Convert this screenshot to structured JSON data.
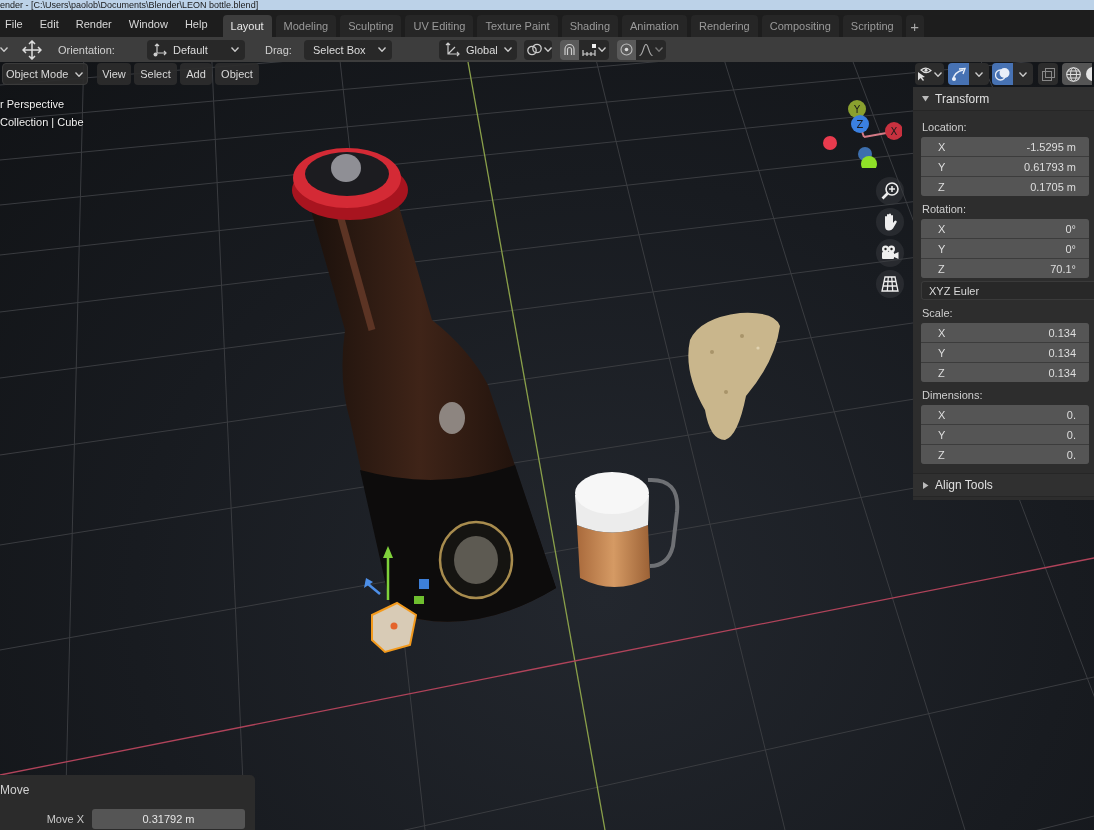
{
  "title_bar": {
    "title": "ender - [C:\\Users\\paolob\\Documents\\Blender\\LEON bottle.blend]"
  },
  "menu_bar": [
    "File",
    "Edit",
    "Render",
    "Window",
    "Help"
  ],
  "workspace_tabs": [
    {
      "label": "Layout",
      "selected": true
    },
    {
      "label": "Modeling",
      "selected": false
    },
    {
      "label": "Sculpting",
      "selected": false
    },
    {
      "label": "UV Editing",
      "selected": false
    },
    {
      "label": "Texture Paint",
      "selected": false
    },
    {
      "label": "Shading",
      "selected": false
    },
    {
      "label": "Animation",
      "selected": false
    },
    {
      "label": "Rendering",
      "selected": false
    },
    {
      "label": "Compositing",
      "selected": false
    },
    {
      "label": "Scripting",
      "selected": false
    }
  ],
  "add_workspace_button": "+",
  "tool_header": {
    "orientation_label": "Orientation:",
    "orientation": "Default",
    "drag_label": "Drag:",
    "drag": "Select Box",
    "transform_orientation": "Global",
    "snap_on": true,
    "proportional_editing_on": true
  },
  "viewport_header": {
    "mode": "Object Mode",
    "menus": [
      "View",
      "Select",
      "Add",
      "Object"
    ],
    "gizmos_on": true,
    "overlays_on": true,
    "xray_on": false
  },
  "viewport_overlay": {
    "view": "r Perspective",
    "collection": "Collection | Cube"
  },
  "navigation_gizmo": {
    "axes": [
      {
        "label": "Y",
        "color": "#8aa02f"
      },
      {
        "label": "Z",
        "color": "#3b80e0"
      },
      {
        "label": "X",
        "color": "#c8313f"
      }
    ],
    "negative_axes": [
      {
        "color": "#e83b4e"
      },
      {
        "color": "#3d6fae"
      },
      {
        "color": "#8fe028"
      }
    ]
  },
  "scene": {
    "cube_selected": true
  },
  "sidebar": {
    "panels": [
      {
        "title": "Transform",
        "expanded": true,
        "items": [
          {
            "kind": "group",
            "label": "Location:",
            "fields": [
              {
                "axis": "X",
                "value": "-1.5295 m"
              },
              {
                "axis": "Y",
                "value": "0.61793 m"
              },
              {
                "axis": "Z",
                "value": "0.1705 m"
              }
            ]
          },
          {
            "kind": "group",
            "label": "Rotation:",
            "fields": [
              {
                "axis": "X",
                "value": "0°"
              },
              {
                "axis": "Y",
                "value": "0°"
              },
              {
                "axis": "Z",
                "value": "70.1°"
              }
            ]
          },
          {
            "kind": "dropdown",
            "value": "XYZ Euler"
          },
          {
            "kind": "group",
            "label": "Scale:",
            "fields": [
              {
                "axis": "X",
                "value": "0.134"
              },
              {
                "axis": "Y",
                "value": "0.134"
              },
              {
                "axis": "Z",
                "value": "0.134"
              }
            ]
          },
          {
            "kind": "group",
            "label": "Dimensions:",
            "fields": [
              {
                "axis": "X",
                "value": "0."
              },
              {
                "axis": "Y",
                "value": "0."
              },
              {
                "axis": "Z",
                "value": "0."
              }
            ]
          }
        ]
      },
      {
        "title": "Align Tools",
        "expanded": false
      }
    ]
  },
  "operator_panel": {
    "title": "Move",
    "fields": [
      {
        "label": "Move X",
        "value": "0.31792 m"
      }
    ]
  }
}
